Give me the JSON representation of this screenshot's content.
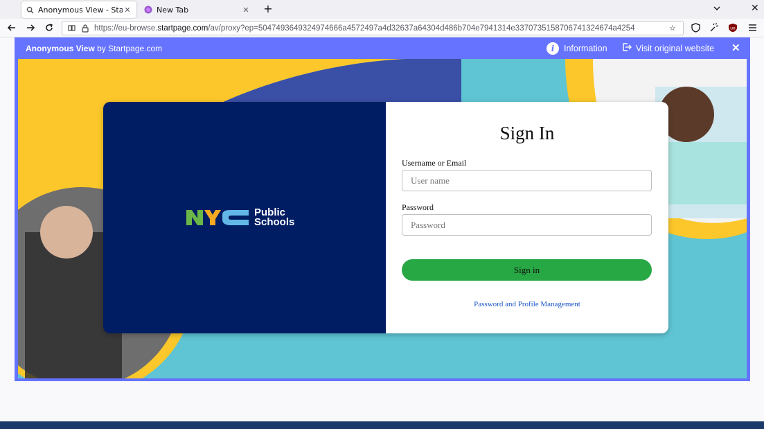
{
  "browser": {
    "tabs": [
      {
        "title": "Anonymous View - Startpage",
        "active": true,
        "favicon": "search-icon"
      },
      {
        "title": "New Tab",
        "active": false,
        "favicon": "firefox-icon"
      }
    ],
    "url_prefix": "https://eu-browse.",
    "url_domain": "startpage.com",
    "url_rest": "/av/proxy?ep=5047493649324974666a4572497a4d32637a64304d486b704e7941314e3370735158706741324674a4254"
  },
  "startpage": {
    "brand_bold": "Anonymous View",
    "brand_rest": " by Startpage.com",
    "info_label": "Information",
    "visit_label": "Visit original website"
  },
  "login": {
    "logo_line1": "Public",
    "logo_line2": "Schools",
    "title": "Sign In",
    "username_label": "Username or Email",
    "username_placeholder": "User name",
    "password_label": "Password",
    "password_placeholder": "Password",
    "signin_label": "Sign in",
    "manage_link": "Password and Profile Management"
  },
  "colors": {
    "frame": "#6573ff",
    "card_left": "#001d63",
    "signin_button": "#28a745",
    "background_teal": "#5fc4d3",
    "accent_yellow": "#fbc72a",
    "accent_blue": "#3a4fa6"
  }
}
